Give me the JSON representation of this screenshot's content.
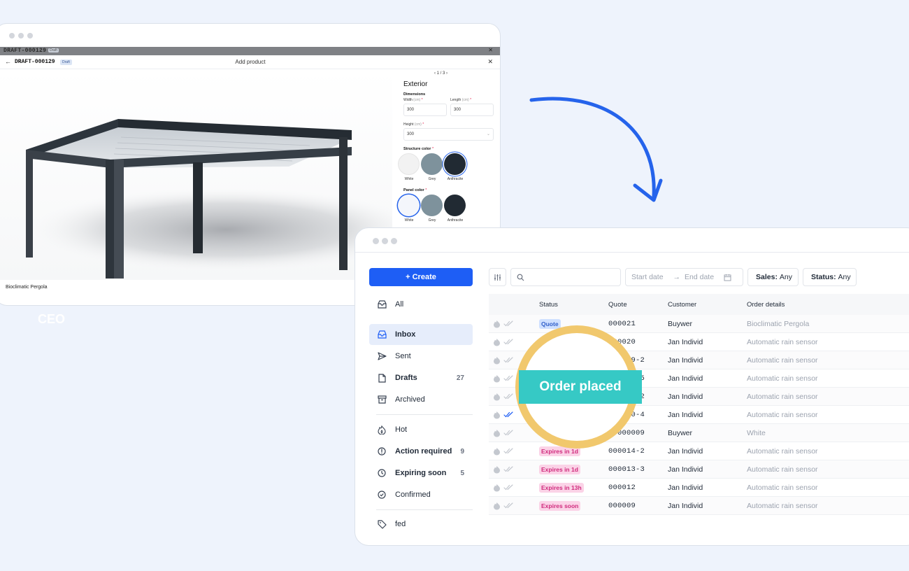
{
  "back_window": {
    "ghost_doc_id": "DRAFT-000129",
    "ghost_badge": "Draft",
    "doc_id": "DRAFT-000129",
    "badge": "Draft",
    "dialog_title": "Add product",
    "product_caption": "Bioclimatic Pergola",
    "config": {
      "pager": "1 / 3",
      "section": "Exterior",
      "dimensions_label": "Dimensions",
      "width_label": "Width",
      "length_label": "Length",
      "height_label": "Height",
      "unit": "(cm)",
      "required_mark": "*",
      "width_value": "300",
      "length_value": "300",
      "height_value": "300",
      "structure_color_label": "Structure color",
      "panel_color_label": "Panel color",
      "colors": [
        {
          "name": "White",
          "hex": "#f2f2f2"
        },
        {
          "name": "Grey",
          "hex": "#7e929c"
        },
        {
          "name": "Anthracite",
          "hex": "#212a33"
        }
      ]
    },
    "ceo_text": "CEO"
  },
  "front_window": {
    "create_label": "+ Create",
    "nav": [
      {
        "label": "All",
        "icon": "inbox-all-icon",
        "count": ""
      },
      {
        "label": "Inbox",
        "icon": "inbox-icon",
        "count": ""
      },
      {
        "label": "Sent",
        "icon": "send-icon",
        "count": ""
      },
      {
        "label": "Drafts",
        "icon": "file-icon",
        "count": "27"
      },
      {
        "label": "Archived",
        "icon": "archive-icon",
        "count": ""
      },
      {
        "label": "Hot",
        "icon": "flame-icon",
        "count": ""
      },
      {
        "label": "Action required",
        "icon": "alert-circle-icon",
        "count": "9"
      },
      {
        "label": "Expiring soon",
        "icon": "clock-icon",
        "count": "5"
      },
      {
        "label": "Confirmed",
        "icon": "check-circle-icon",
        "count": ""
      },
      {
        "label": "fed",
        "icon": "tag-icon",
        "count": ""
      }
    ],
    "filters": {
      "start_date": "Start date",
      "end_date": "End date",
      "arrow": "→",
      "sales_label": "Sales:",
      "sales_value": "Any",
      "status_label": "Status:",
      "status_value": "Any"
    },
    "table": {
      "headers": [
        "Status",
        "Quote",
        "Customer",
        "Order details"
      ],
      "rows": [
        {
          "status": "Quote",
          "status_color": "blue",
          "quote": "000021",
          "customer": "Buywer",
          "details": "Bioclimatic Pergola",
          "confirmed": false
        },
        {
          "status": "",
          "status_color": "",
          "quote": "000020",
          "customer": "Jan Individ",
          "details": "Automatic rain sensor",
          "confirmed": false
        },
        {
          "status": "",
          "status_color": "",
          "quote": "000019-2",
          "customer": "Jan Individ",
          "details": "Automatic rain sensor",
          "confirmed": false
        },
        {
          "status": "",
          "status_color": "",
          "quote": "000012-5",
          "customer": "Jan Individ",
          "details": "Automatic rain sensor",
          "confirmed": false
        },
        {
          "status": "",
          "status_color": "",
          "quote": "000011-2",
          "customer": "Jan Individ",
          "details": "Automatic rain sensor",
          "confirmed": false
        },
        {
          "status": "",
          "status_color": "",
          "quote": "000010-4",
          "customer": "Jan Individ",
          "details": "Automatic rain sensor",
          "confirmed": true
        },
        {
          "status": "",
          "status_color": "",
          "quote": "RD000009",
          "customer": "Buywer",
          "details": "White",
          "confirmed": false
        },
        {
          "status": "Expires in 1d",
          "status_color": "pink",
          "quote": "000014-2",
          "customer": "Jan Individ",
          "details": "Automatic rain sensor",
          "confirmed": false
        },
        {
          "status": "Expires in 1d",
          "status_color": "pink",
          "quote": "000013-3",
          "customer": "Jan Individ",
          "details": "Automatic rain sensor",
          "confirmed": false
        },
        {
          "status": "Expires in 13h",
          "status_color": "pink",
          "quote": "000012",
          "customer": "Jan Individ",
          "details": "Automatic rain sensor",
          "confirmed": false
        },
        {
          "status": "Expires soon",
          "status_color": "pink",
          "quote": "000009",
          "customer": "Jan Individ",
          "details": "Automatic rain sensor",
          "confirmed": false
        }
      ]
    }
  },
  "overlay_label": "Order placed",
  "colors": {
    "accent": "#1e5ef5",
    "arrow": "#2563eb",
    "overlay_ring": "#f1c86d",
    "overlay_band": "#36c9c5"
  }
}
